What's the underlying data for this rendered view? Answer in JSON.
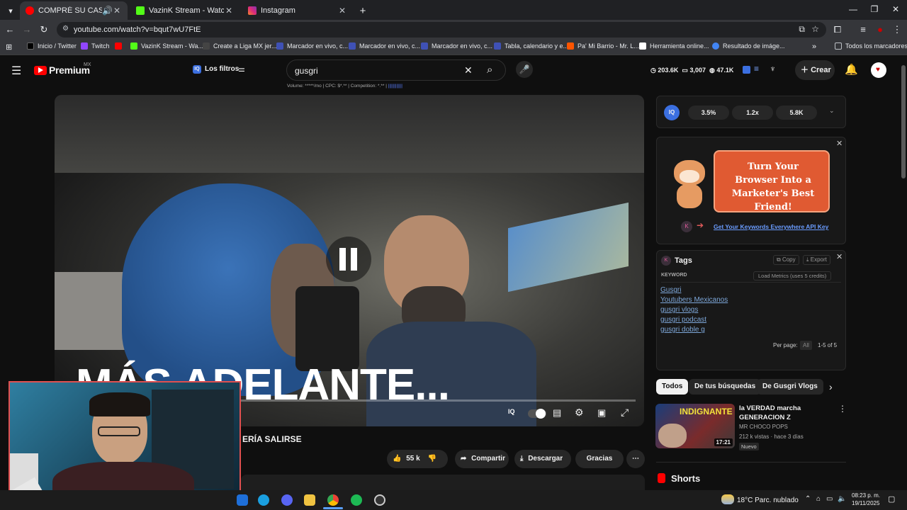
{
  "browser": {
    "tabs": [
      {
        "title": "COMPRÉ SU CASA EN UN P",
        "active": true
      },
      {
        "title": "VazinK Stream - Watch Live on",
        "active": false
      },
      {
        "title": "Instagram",
        "active": false
      }
    ],
    "new_tab": "+",
    "url": "youtube.com/watch?v=bqut7wU7FtE",
    "bookmarks": [
      {
        "label": "Inicio / Twitter",
        "color": "#000000"
      },
      {
        "label": "Twitch",
        "color": "#9146ff"
      },
      {
        "label": "",
        "color": "#ff0000"
      },
      {
        "label": "VazinK Stream - Wa...",
        "color": "#53fc18"
      },
      {
        "label": "Create a Liga MX jer...",
        "color": "#444444"
      },
      {
        "label": "Marcador en vivo, c...",
        "color": "#3f51b5"
      },
      {
        "label": "Marcador en vivo, c...",
        "color": "#3f51b5"
      },
      {
        "label": "Marcador en vivo, c...",
        "color": "#3f51b5"
      },
      {
        "label": "Tabla, calendario y e...",
        "color": "#3f51b5"
      },
      {
        "label": "Pa' Mi Barrio - Mr. L...",
        "color": "#ff5500"
      },
      {
        "label": "Herramienta online...",
        "color": "#ffffff"
      },
      {
        "label": "Resultado de imáge...",
        "color": "#4285f4"
      }
    ],
    "bookmarks_more": "»",
    "all_bookmarks": "Todos los marcadores"
  },
  "youtube": {
    "logo": "Premium",
    "region": "MX",
    "filters_label": "Los filtros",
    "search_value": "gusgri",
    "search_meta": "Volume: *****/mo | CPC: $*.** | Competition: *.** |",
    "stats": {
      "views": "203.6K",
      "comments": "3,007",
      "likes": "47.1K"
    },
    "create_label": "Crear",
    "video_caption": "MÁS ADELANTE...",
    "title_fragment": "ERÍA SALIRSE",
    "like_count": "55 k",
    "share_label": "Compartir",
    "download_label": "Descargar",
    "thanks_label": "Gracias"
  },
  "vidiq": {
    "badge": "IQ",
    "metrics": [
      "3.5%",
      "1.2x",
      "5.8K"
    ],
    "promo_text": "Turn Your Browser Into a Marketer's Best Friend!",
    "promo_link": "Get Your Keywords Everywhere API Key",
    "tags_title": "Tags",
    "copy_label": "Copy",
    "export_label": "Export",
    "keyword_header": "KEYWORD",
    "load_metrics": "Load Metrics (uses 5 credits)",
    "keywords": [
      "Gusgri",
      "Youtubers Mexicanos",
      "gusgri vlogs",
      "gusgri podcast",
      "gusgri doble g"
    ],
    "per_page_label": "Per page:",
    "per_page_value": "All",
    "range": "1-5 of 5"
  },
  "recommendations": {
    "chips": [
      "Todos",
      "De tus búsquedas",
      "De Gusgri Vlogs"
    ],
    "video": {
      "thumb_text": "INDIGNANTE",
      "duration": "17:21",
      "title": "la VERDAD marcha GENERACION Z",
      "channel": "MR CHOCO POPS",
      "meta": "212 k vistas · hace 3 días",
      "badge": "Nuevo"
    },
    "shorts_title": "Shorts"
  },
  "taskbar": {
    "weather": "18°C  Parc. nublado",
    "time": "08:23 p. m.",
    "date": "19/11/2025"
  }
}
